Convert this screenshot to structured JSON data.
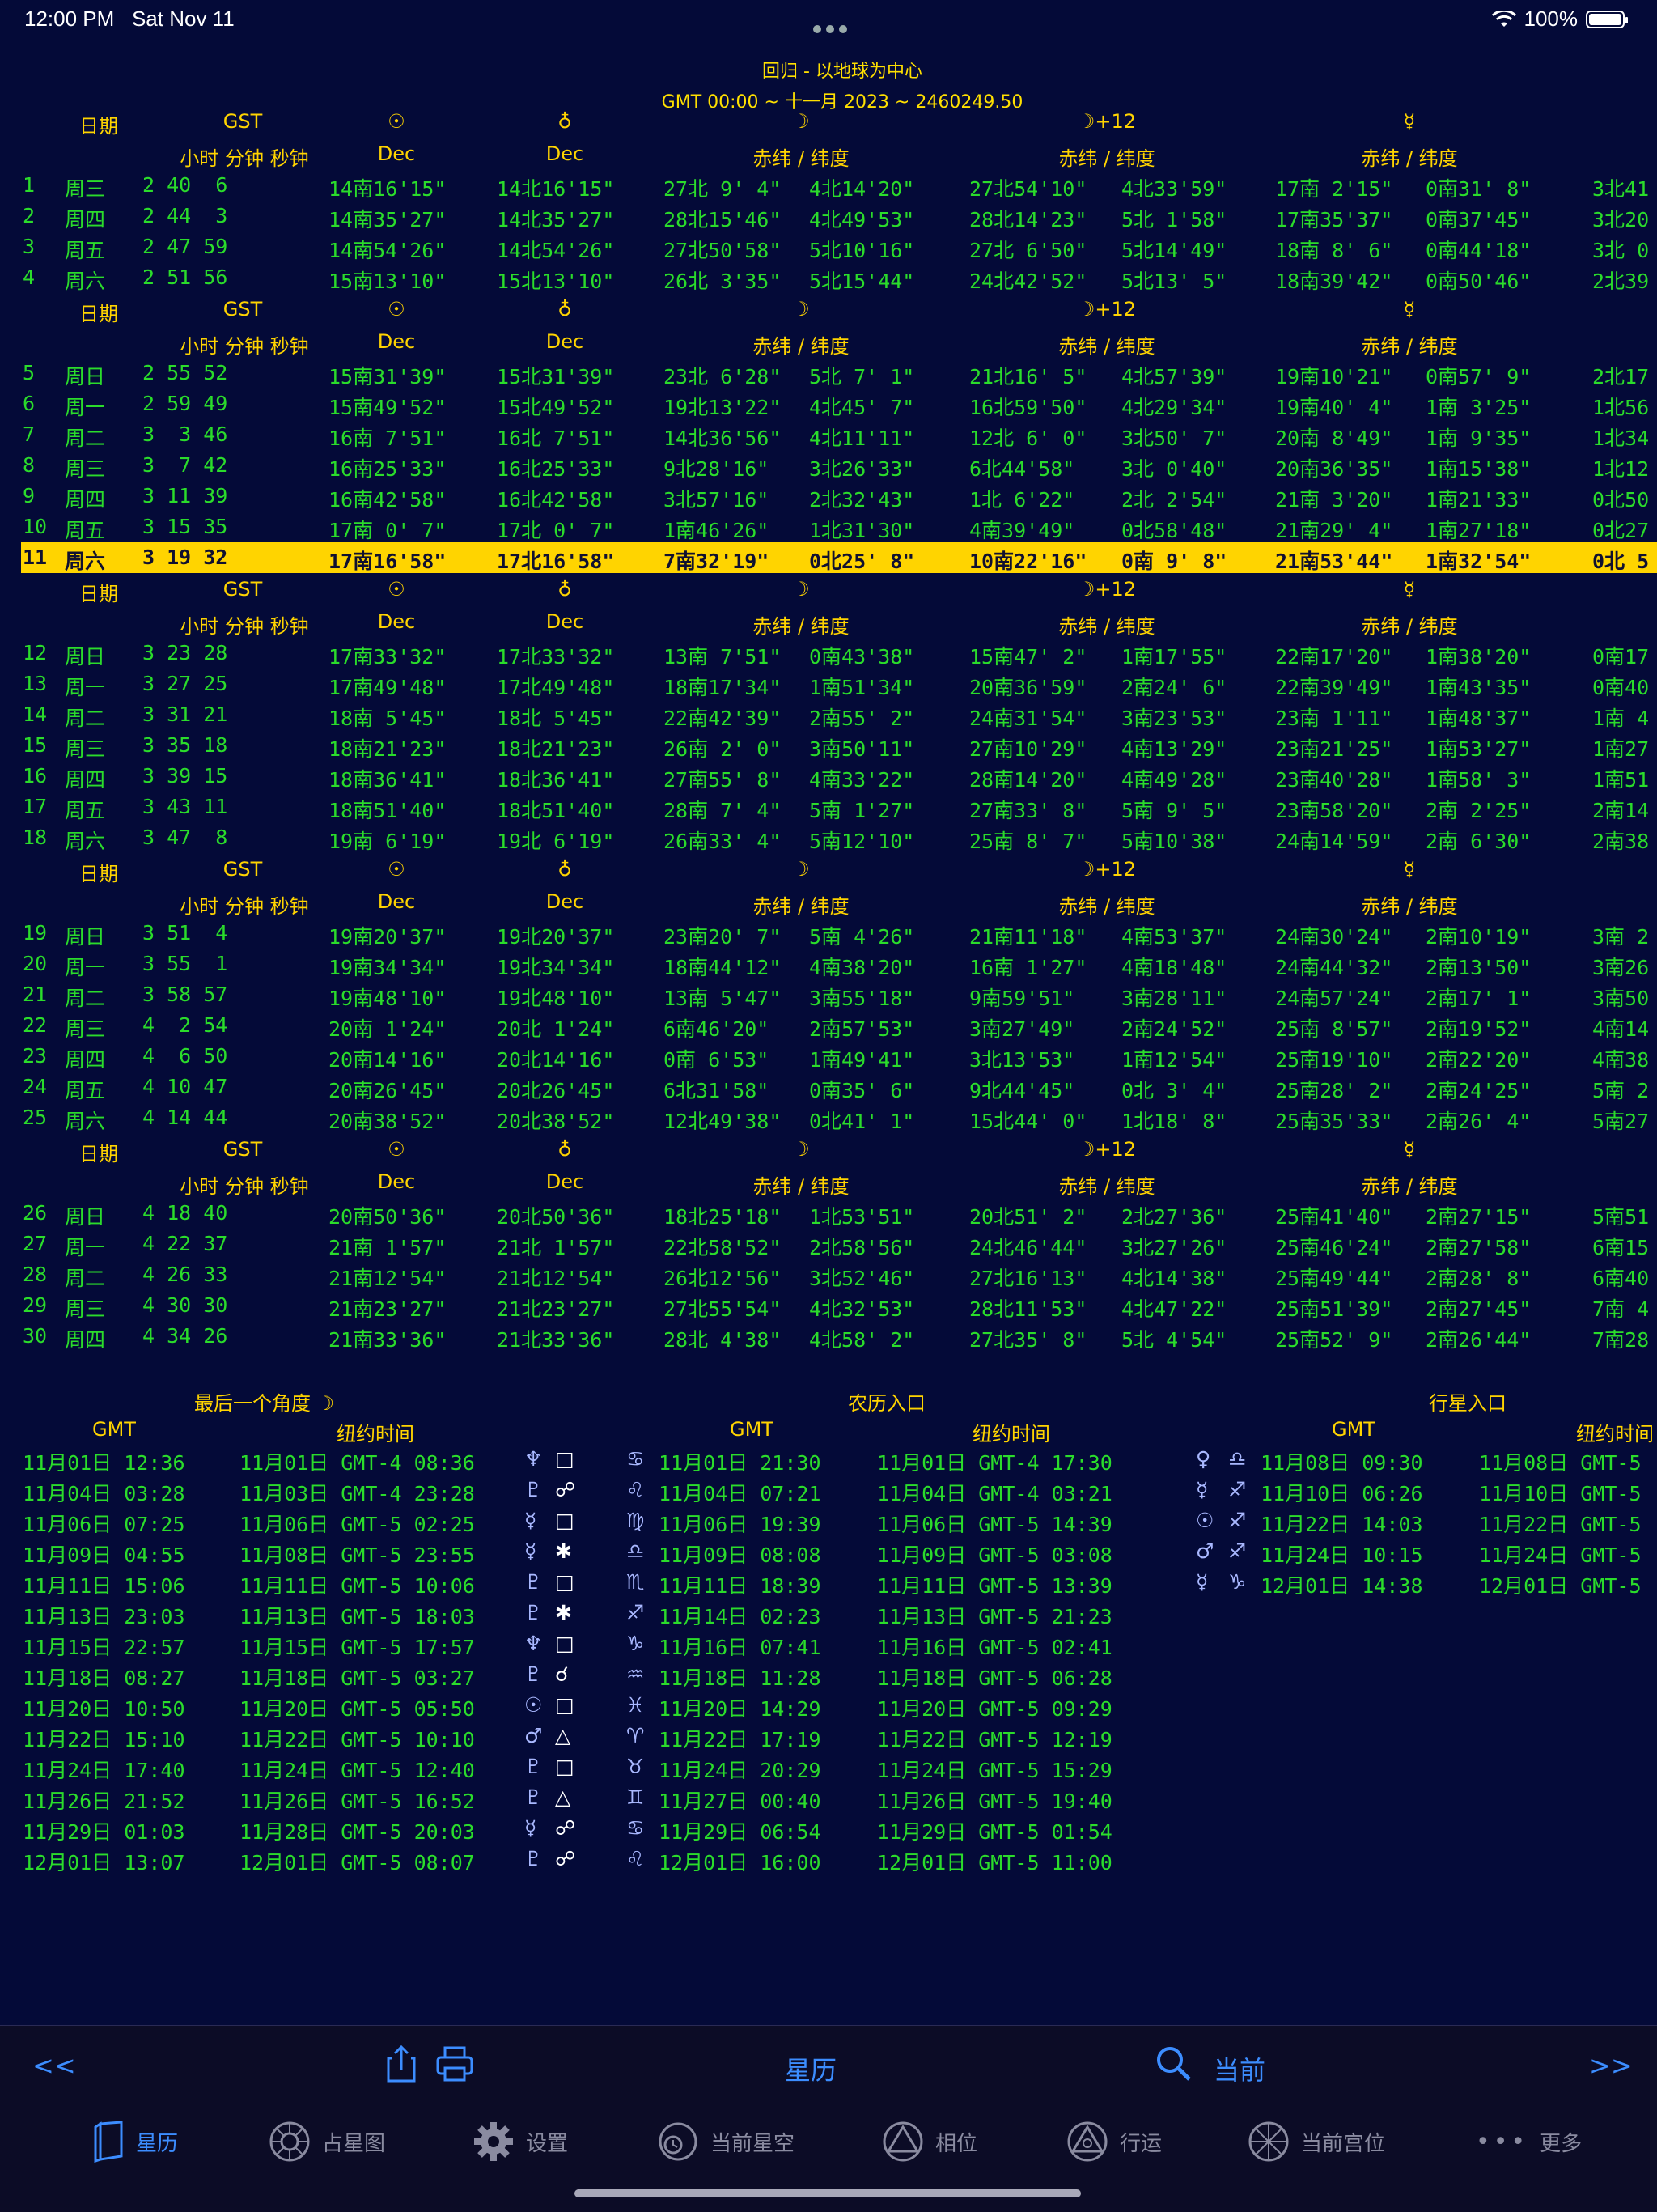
{
  "status": {
    "time": "12:00 PM",
    "date": "Sat Nov 11",
    "battery": "100%"
  },
  "title": {
    "line1": "回归 - 以地球为中心",
    "line2": "GMT 00:00 ~ 十一月 2023 ~ 2460249.50"
  },
  "header": {
    "date": "日期",
    "gst": "GST",
    "sun": "☉",
    "uranus_sym": "♁",
    "moon": "☽",
    "moon12": "☽+12",
    "mercury": "☿",
    "hms": "小时 分钟 秒钟",
    "dec": "Dec",
    "eclip": "赤纬 / 纬度"
  },
  "rows": [
    [
      "1",
      "周三",
      "2 40  6",
      "14南16'15\"",
      "14北16'15\"",
      "27北 9' 4\"",
      "4北14'20\"",
      "27北54'10\"",
      "4北33'59\"",
      "17南 2'15\"",
      "0南31' 8\"",
      "3北41"
    ],
    [
      "2",
      "周四",
      "2 44  3",
      "14南35'27\"",
      "14北35'27\"",
      "28北15'46\"",
      "4北49'53\"",
      "28北14'23\"",
      "5北 1'58\"",
      "17南35'37\"",
      "0南37'45\"",
      "3北20"
    ],
    [
      "3",
      "周五",
      "2 47 59",
      "14南54'26\"",
      "14北54'26\"",
      "27北50'58\"",
      "5北10'16\"",
      "27北 6'50\"",
      "5北14'49\"",
      "18南 8' 6\"",
      "0南44'18\"",
      "3北 0"
    ],
    [
      "4",
      "周六",
      "2 51 56",
      "15南13'10\"",
      "15北13'10\"",
      "26北 3'35\"",
      "5北15'44\"",
      "24北42'52\"",
      "5北13' 5\"",
      "18南39'42\"",
      "0南50'46\"",
      "2北39"
    ],
    [
      "5",
      "周日",
      "2 55 52",
      "15南31'39\"",
      "15北31'39\"",
      "23北 6'28\"",
      "5北 7' 1\"",
      "21北16' 5\"",
      "4北57'39\"",
      "19南10'21\"",
      "0南57' 9\"",
      "2北17"
    ],
    [
      "6",
      "周一",
      "2 59 49",
      "15南49'52\"",
      "15北49'52\"",
      "19北13'22\"",
      "4北45' 7\"",
      "16北59'50\"",
      "4北29'34\"",
      "19南40' 4\"",
      "1南 3'25\"",
      "1北56"
    ],
    [
      "7",
      "周二",
      "3  3 46",
      "16南 7'51\"",
      "16北 7'51\"",
      "14北36'56\"",
      "4北11'11\"",
      "12北 6' 0\"",
      "3北50' 7\"",
      "20南 8'49\"",
      "1南 9'35\"",
      "1北34"
    ],
    [
      "8",
      "周三",
      "3  7 42",
      "16南25'33\"",
      "16北25'33\"",
      "9北28'16\"",
      "3北26'33\"",
      "6北44'58\"",
      "3北 0'40\"",
      "20南36'35\"",
      "1南15'38\"",
      "1北12"
    ],
    [
      "9",
      "周四",
      "3 11 39",
      "16南42'58\"",
      "16北42'58\"",
      "3北57'16\"",
      "2北32'43\"",
      "1北 6'22\"",
      "2北 2'54\"",
      "21南 3'20\"",
      "1南21'33\"",
      "0北50"
    ],
    [
      "10",
      "周五",
      "3 15 35",
      "17南 0' 7\"",
      "17北 0' 7\"",
      "1南46'26\"",
      "1北31'30\"",
      "4南39'49\"",
      "0北58'48\"",
      "21南29' 4\"",
      "1南27'18\"",
      "0北27"
    ],
    [
      "11",
      "周六",
      "3 19 32",
      "17南16'58\"",
      "17北16'58\"",
      "7南32'19\"",
      "0北25' 8\"",
      "10南22'16\"",
      "0南 9' 8\"",
      "21南53'44\"",
      "1南32'54\"",
      "0北 5"
    ],
    [
      "12",
      "周日",
      "3 23 28",
      "17南33'32\"",
      "17北33'32\"",
      "13南 7'51\"",
      "0南43'38\"",
      "15南47' 2\"",
      "1南17'55\"",
      "22南17'20\"",
      "1南38'20\"",
      "0南17"
    ],
    [
      "13",
      "周一",
      "3 27 25",
      "17南49'48\"",
      "17北49'48\"",
      "18南17'34\"",
      "1南51'34\"",
      "20南36'59\"",
      "2南24' 6\"",
      "22南39'49\"",
      "1南43'35\"",
      "0南40"
    ],
    [
      "14",
      "周二",
      "3 31 21",
      "18南 5'45\"",
      "18北 5'45\"",
      "22南42'39\"",
      "2南55' 2\"",
      "24南31'54\"",
      "3南23'53\"",
      "23南 1'11\"",
      "1南48'37\"",
      "1南 4"
    ],
    [
      "15",
      "周三",
      "3 35 18",
      "18南21'23\"",
      "18北21'23\"",
      "26南 2' 0\"",
      "3南50'11\"",
      "27南10'29\"",
      "4南13'29\"",
      "23南21'25\"",
      "1南53'27\"",
      "1南27"
    ],
    [
      "16",
      "周四",
      "3 39 15",
      "18南36'41\"",
      "18北36'41\"",
      "27南55' 8\"",
      "4南33'22\"",
      "28南14'20\"",
      "4南49'28\"",
      "23南40'28\"",
      "1南58' 3\"",
      "1南51"
    ],
    [
      "17",
      "周五",
      "3 43 11",
      "18南51'40\"",
      "18北51'40\"",
      "28南 7' 4\"",
      "5南 1'27\"",
      "27南33' 8\"",
      "5南 9' 5\"",
      "23南58'20\"",
      "2南 2'25\"",
      "2南14"
    ],
    [
      "18",
      "周六",
      "3 47  8",
      "19南 6'19\"",
      "19北 6'19\"",
      "26南33' 4\"",
      "5南12'10\"",
      "25南 8' 7\"",
      "5南10'38\"",
      "24南14'59\"",
      "2南 6'30\"",
      "2南38"
    ],
    [
      "19",
      "周日",
      "3 51  4",
      "19南20'37\"",
      "19北20'37\"",
      "23南20' 7\"",
      "5南 4'26\"",
      "21南11'18\"",
      "4南53'37\"",
      "24南30'24\"",
      "2南10'19\"",
      "3南 2"
    ],
    [
      "20",
      "周一",
      "3 55  1",
      "19南34'34\"",
      "19北34'34\"",
      "18南44'12\"",
      "4南38'20\"",
      "16南 1'27\"",
      "4南18'48\"",
      "24南44'32\"",
      "2南13'50\"",
      "3南26"
    ],
    [
      "21",
      "周二",
      "3 58 57",
      "19南48'10\"",
      "19北48'10\"",
      "13南 5'47\"",
      "3南55'18\"",
      "9南59'51\"",
      "3南28'11\"",
      "24南57'24\"",
      "2南17' 1\"",
      "3南50"
    ],
    [
      "22",
      "周三",
      "4  2 54",
      "20南 1'24\"",
      "20北 1'24\"",
      "6南46'20\"",
      "2南57'53\"",
      "3南27'49\"",
      "2南24'52\"",
      "25南 8'57\"",
      "2南19'52\"",
      "4南14"
    ],
    [
      "23",
      "周四",
      "4  6 50",
      "20南14'16\"",
      "20北14'16\"",
      "0南 6'53\"",
      "1南49'41\"",
      "3北13'53\"",
      "1南12'54\"",
      "25南19'10\"",
      "2南22'20\"",
      "4南38"
    ],
    [
      "24",
      "周五",
      "4 10 47",
      "20南26'45\"",
      "20北26'45\"",
      "6北31'58\"",
      "0南35' 6\"",
      "9北44'45\"",
      "0北 3' 4\"",
      "25南28' 2\"",
      "2南24'25\"",
      "5南 2"
    ],
    [
      "25",
      "周六",
      "4 14 44",
      "20南38'52\"",
      "20北38'52\"",
      "12北49'38\"",
      "0北41' 1\"",
      "15北44' 0\"",
      "1北18' 8\"",
      "25南35'33\"",
      "2南26' 4\"",
      "5南27"
    ],
    [
      "26",
      "周日",
      "4 18 40",
      "20南50'36\"",
      "20北50'36\"",
      "18北25'18\"",
      "1北53'51\"",
      "20北51' 2\"",
      "2北27'36\"",
      "25南41'40\"",
      "2南27'15\"",
      "5南51"
    ],
    [
      "27",
      "周一",
      "4 22 37",
      "21南 1'57\"",
      "21北 1'57\"",
      "22北58'52\"",
      "2北58'56\"",
      "24北46'44\"",
      "3北27'26\"",
      "25南46'24\"",
      "2南27'58\"",
      "6南15"
    ],
    [
      "28",
      "周二",
      "4 26 33",
      "21南12'54\"",
      "21北12'54\"",
      "26北12'56\"",
      "3北52'46\"",
      "27北16'13\"",
      "4北14'38\"",
      "25南49'44\"",
      "2南28' 8\"",
      "6南40"
    ],
    [
      "29",
      "周三",
      "4 30 30",
      "21南23'27\"",
      "21北23'27\"",
      "27北55'54\"",
      "4北32'53\"",
      "28北11'53\"",
      "4北47'22\"",
      "25南51'39\"",
      "2南27'45\"",
      "7南 4"
    ],
    [
      "30",
      "周四",
      "4 34 26",
      "21南33'36\"",
      "21北33'36\"",
      "28北 4'38\"",
      "4北58' 2\"",
      "27北35' 8\"",
      "5北 4'54\"",
      "25南52' 9\"",
      "2南26'44\"",
      "7南28"
    ]
  ],
  "highlight_day": "11",
  "last_aspect": {
    "title": "最后一个角度  ☽",
    "col_gmt": "GMT",
    "col_ny": "纽约时间",
    "rows": [
      [
        "11月01日 12:36",
        "11月01日 GMT-4 08:36",
        "♆",
        "□"
      ],
      [
        "11月04日 03:28",
        "11月03日 GMT-4 23:28",
        "♇",
        "☍"
      ],
      [
        "11月06日 07:25",
        "11月06日 GMT-5 02:25",
        "☿",
        "□"
      ],
      [
        "11月09日 04:55",
        "11月08日 GMT-5 23:55",
        "☿",
        "✱"
      ],
      [
        "11月11日 15:06",
        "11月11日 GMT-5 10:06",
        "♇",
        "□"
      ],
      [
        "11月13日 23:03",
        "11月13日 GMT-5 18:03",
        "♇",
        "✱"
      ],
      [
        "11月15日 22:57",
        "11月15日 GMT-5 17:57",
        "♆",
        "□"
      ],
      [
        "11月18日 08:27",
        "11月18日 GMT-5 03:27",
        "♇",
        "☌"
      ],
      [
        "11月20日 10:50",
        "11月20日 GMT-5 05:50",
        "☉",
        "□"
      ],
      [
        "11月22日 15:10",
        "11月22日 GMT-5 10:10",
        "♂",
        "△"
      ],
      [
        "11月24日 17:40",
        "11月24日 GMT-5 12:40",
        "♇",
        "□"
      ],
      [
        "11月26日 21:52",
        "11月26日 GMT-5 16:52",
        "♇",
        "△"
      ],
      [
        "11月29日 01:03",
        "11月28日 GMT-5 20:03",
        "☿",
        "☍"
      ],
      [
        "12月01日 13:07",
        "12月01日 GMT-5 08:07",
        "♇",
        "☍"
      ]
    ]
  },
  "lunar_entry": {
    "title": "农历入口",
    "col_gmt": "GMT",
    "col_ny": "纽约时间",
    "rows": [
      [
        "♋",
        "11月01日 21:30",
        "11月01日 GMT-4 17:30"
      ],
      [
        "♌",
        "11月04日 07:21",
        "11月04日 GMT-4 03:21"
      ],
      [
        "♍",
        "11月06日 19:39",
        "11月06日 GMT-5 14:39"
      ],
      [
        "♎",
        "11月09日 08:08",
        "11月09日 GMT-5 03:08"
      ],
      [
        "♏",
        "11月11日 18:39",
        "11月11日 GMT-5 13:39"
      ],
      [
        "♐",
        "11月14日 02:23",
        "11月13日 GMT-5 21:23"
      ],
      [
        "♑",
        "11月16日 07:41",
        "11月16日 GMT-5 02:41"
      ],
      [
        "♒",
        "11月18日 11:28",
        "11月18日 GMT-5 06:28"
      ],
      [
        "♓",
        "11月20日 14:29",
        "11月20日 GMT-5 09:29"
      ],
      [
        "♈",
        "11月22日 17:19",
        "11月22日 GMT-5 12:19"
      ],
      [
        "♉",
        "11月24日 20:29",
        "11月24日 GMT-5 15:29"
      ],
      [
        "♊",
        "11月27日 00:40",
        "11月26日 GMT-5 19:40"
      ],
      [
        "♋",
        "11月29日 06:54",
        "11月29日 GMT-5 01:54"
      ],
      [
        "♌",
        "12月01日 16:00",
        "12月01日 GMT-5 11:00"
      ]
    ]
  },
  "planet_entry": {
    "title": "行星入口",
    "col_gmt": "GMT",
    "col_ny": "纽约时间",
    "rows": [
      [
        "♀",
        "♎",
        "11月08日 09:30",
        "11月08日 GMT-5"
      ],
      [
        "☿",
        "♐",
        "11月10日 06:26",
        "11月10日 GMT-5"
      ],
      [
        "☉",
        "♐",
        "11月22日 14:03",
        "11月22日 GMT-5"
      ],
      [
        "♂",
        "♐",
        "11月24日 10:15",
        "11月24日 GMT-5"
      ],
      [
        "☿",
        "♑",
        "12月01日 14:38",
        "12月01日 GMT-5"
      ]
    ]
  },
  "toolbar": {
    "prev": "<<",
    "next": ">>",
    "center": "星历",
    "current": "当前"
  },
  "tabs": [
    "星历",
    "占星图",
    "设置",
    "当前星空",
    "相位",
    "行运",
    "当前宫位",
    "更多"
  ],
  "colors": {
    "background": "#040a38",
    "data": "#2bdc2b",
    "header": "#ffd400",
    "highlight": "#ffd400",
    "accent": "#3c8dff"
  }
}
